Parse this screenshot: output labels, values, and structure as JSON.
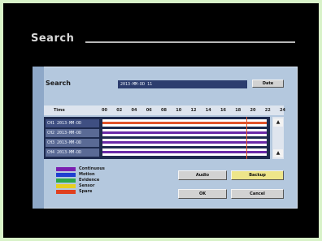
{
  "screen": {
    "title": "Search"
  },
  "search": {
    "label": "Search",
    "date_value": "2013-MM-DD 11",
    "date_button": "Date"
  },
  "timeline": {
    "time_label": "Time",
    "hours": [
      "00",
      "02",
      "04",
      "06",
      "08",
      "10",
      "12",
      "14",
      "16",
      "18",
      "20",
      "22",
      "24"
    ],
    "rows": [
      {
        "label": "CH1 2013-MM-DD",
        "selected": true,
        "bars": [
          {
            "color": "#e2542a",
            "start": 0,
            "end": 24
          }
        ]
      },
      {
        "label": "CH2 2013-MM-DD",
        "selected": false,
        "bars": [
          {
            "color": "#6a2aa8",
            "start": 0,
            "end": 24
          }
        ]
      },
      {
        "label": "CH3 2013-MM-DD",
        "selected": false,
        "bars": [
          {
            "color": "#6a2aa8",
            "start": 0,
            "end": 24
          }
        ]
      },
      {
        "label": "CH4 2013-MM-DD",
        "selected": false,
        "bars": [
          {
            "color": "#6a2aa8",
            "start": 0,
            "end": 24
          }
        ]
      }
    ],
    "cursor_hour": 21,
    "scroll_up": "▲",
    "scroll_down": "▲"
  },
  "legend": [
    {
      "label": "Continuous",
      "color": "#7a1fb0"
    },
    {
      "label": "Motion",
      "color": "#1f3fd0"
    },
    {
      "label": "Evidence",
      "color": "#2ea84a"
    },
    {
      "label": "Sensor",
      "color": "#e8cf1f"
    },
    {
      "label": "Spare",
      "color": "#e0401f"
    }
  ],
  "buttons": {
    "audio": "Audio",
    "backup": "Backup",
    "ok": "OK",
    "cancel": "Cancel"
  }
}
